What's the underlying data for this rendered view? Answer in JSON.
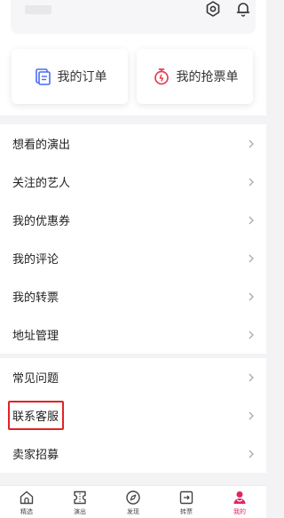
{
  "header": {
    "settings_icon": "settings-icon",
    "bell_icon": "bell-icon"
  },
  "quick_actions": [
    {
      "label": "我的订单",
      "icon": "order-icon",
      "color": "#4a6cf7"
    },
    {
      "label": "我的抢票单",
      "icon": "stopwatch-icon",
      "color": "#e53e4f"
    }
  ],
  "menu_group_1": [
    {
      "label": "想看的演出"
    },
    {
      "label": "关注的艺人"
    },
    {
      "label": "我的优惠券"
    },
    {
      "label": "我的评论"
    },
    {
      "label": "我的转票"
    },
    {
      "label": "地址管理"
    }
  ],
  "menu_group_2": [
    {
      "label": "常见问题"
    },
    {
      "label": "联系客服"
    },
    {
      "label": "卖家招募"
    }
  ],
  "tabbar": [
    {
      "label": "精选",
      "icon": "home-icon"
    },
    {
      "label": "演出",
      "icon": "ticket-icon"
    },
    {
      "label": "发现",
      "icon": "compass-icon"
    },
    {
      "label": "转票",
      "icon": "transfer-icon"
    },
    {
      "label": "我的",
      "icon": "profile-icon",
      "active": true
    }
  ],
  "colors": {
    "accent": "#e0245e",
    "highlight": "#e02424"
  }
}
